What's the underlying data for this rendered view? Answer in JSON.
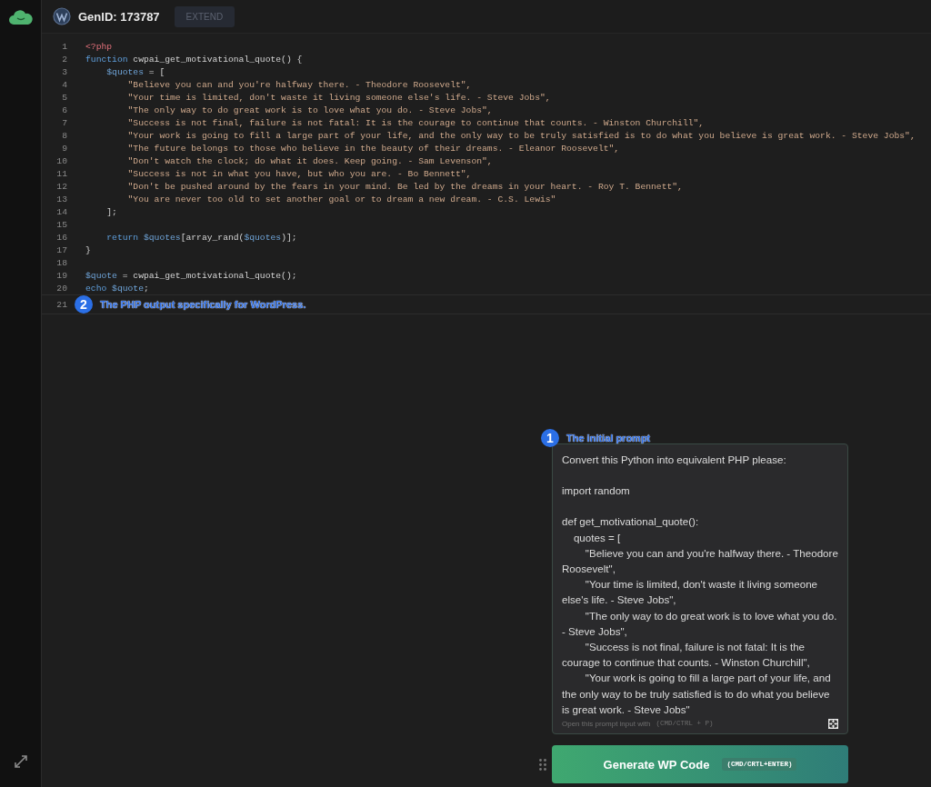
{
  "header": {
    "gen_id": "GenID: 173787",
    "extend_button": {
      "label": "EXTEND",
      "disabled": true
    }
  },
  "editor": {
    "lines": [
      {
        "number": "1",
        "tokens": [
          {
            "kind": "tag",
            "text": "<?php"
          }
        ]
      },
      {
        "number": "2",
        "tokens": [
          {
            "kind": "keyword",
            "text": "function"
          },
          {
            "kind": "plain",
            "text": " cwpai_get_motivational_quote() {"
          }
        ]
      },
      {
        "number": "3",
        "tokens": [
          {
            "kind": "variable",
            "text": "    $quotes"
          },
          {
            "kind": "plain",
            "text": " = ["
          }
        ]
      },
      {
        "number": "4",
        "tokens": [
          {
            "kind": "string",
            "text": "        \"Believe you can and you're halfway there. - Theodore Roosevelt\","
          }
        ]
      },
      {
        "number": "5",
        "tokens": [
          {
            "kind": "string",
            "text": "        \"Your time is limited, don't waste it living someone else's life. - Steve Jobs\","
          }
        ]
      },
      {
        "number": "6",
        "tokens": [
          {
            "kind": "string",
            "text": "        \"The only way to do great work is to love what you do. - Steve Jobs\","
          }
        ]
      },
      {
        "number": "7",
        "tokens": [
          {
            "kind": "string",
            "text": "        \"Success is not final, failure is not fatal: It is the courage to continue that counts. - Winston Churchill\","
          }
        ]
      },
      {
        "number": "8",
        "tokens": [
          {
            "kind": "string",
            "text": "        \"Your work is going to fill a large part of your life, and the only way to be truly satisfied is to do what you believe is great work. - Steve Jobs\","
          }
        ]
      },
      {
        "number": "9",
        "tokens": [
          {
            "kind": "string",
            "text": "        \"The future belongs to those who believe in the beauty of their dreams. - Eleanor Roosevelt\","
          }
        ]
      },
      {
        "number": "10",
        "tokens": [
          {
            "kind": "string",
            "text": "        \"Don't watch the clock; do what it does. Keep going. - Sam Levenson\","
          }
        ]
      },
      {
        "number": "11",
        "tokens": [
          {
            "kind": "string",
            "text": "        \"Success is not in what you have, but who you are. - Bo Bennett\","
          }
        ]
      },
      {
        "number": "12",
        "tokens": [
          {
            "kind": "string",
            "text": "        \"Don't be pushed around by the fears in your mind. Be led by the dreams in your heart. - Roy T. Bennett\","
          }
        ]
      },
      {
        "number": "13",
        "tokens": [
          {
            "kind": "string",
            "text": "        \"You are never too old to set another goal or to dream a new dream. - C.S. Lewis\""
          }
        ]
      },
      {
        "number": "14",
        "tokens": [
          {
            "kind": "plain",
            "text": "    ];"
          }
        ]
      },
      {
        "number": "15"
      },
      {
        "number": "16",
        "tokens": [
          {
            "kind": "keyword",
            "text": "    return"
          },
          {
            "kind": "variable",
            "text": " $quotes"
          },
          {
            "kind": "plain",
            "text": "[array_rand("
          },
          {
            "kind": "variable",
            "text": "$quotes"
          },
          {
            "kind": "plain",
            "text": ")];"
          }
        ]
      },
      {
        "number": "17",
        "tokens": [
          {
            "kind": "plain",
            "text": "}"
          }
        ]
      },
      {
        "number": "18"
      },
      {
        "number": "19",
        "tokens": [
          {
            "kind": "variable",
            "text": "$quote"
          },
          {
            "kind": "plain",
            "text": " = cwpai_get_motivational_quote();"
          }
        ]
      },
      {
        "number": "20",
        "tokens": [
          {
            "kind": "keyword",
            "text": "echo"
          },
          {
            "kind": "variable",
            "text": " $quote"
          },
          {
            "kind": "plain",
            "text": ";"
          }
        ]
      },
      {
        "number": "21",
        "active": true,
        "annotation": {
          "number": "2",
          "label": "The PHP output specifically for WordPress."
        }
      }
    ]
  },
  "prompt": {
    "annotation": {
      "number": "1",
      "label": "The initial prompt"
    },
    "value": "Convert this Python into equivalent PHP please:\n\nimport random\n\ndef get_motivational_quote():\n    quotes = [\n        \"Believe you can and you're halfway there. - Theodore Roosevelt\",\n        \"Your time is limited, don't waste it living someone else's life. - Steve Jobs\",\n        \"The only way to do great work is to love what you do. - Steve Jobs\",\n        \"Success is not final, failure is not fatal: It is the courage to continue that counts. - Winston Churchill\",\n        \"Your work is going to fill a large part of your life, and the only way to be truly satisfied is to do what you believe is great work. - Steve Jobs\"",
    "hint": "Open this prompt input with",
    "hint_shortcut": "(CMD/CTRL + P)"
  },
  "generate_button": {
    "label": "Generate WP Code",
    "shortcut": "(CMD/CRTL+ENTER)"
  }
}
